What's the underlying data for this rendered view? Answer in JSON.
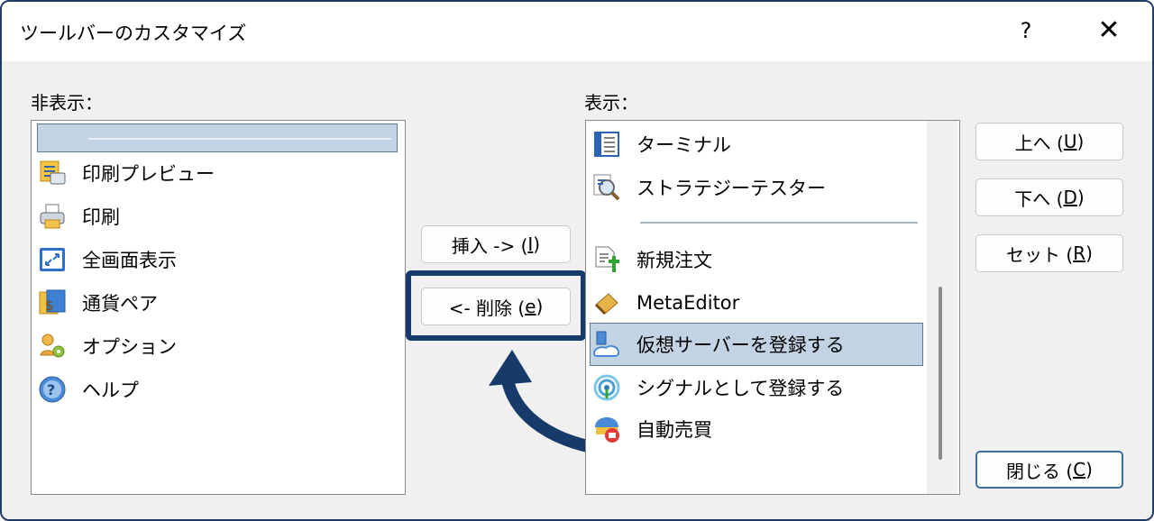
{
  "dialog": {
    "title": "ツールバーのカスタマイズ",
    "help_label": "?",
    "close_label": "✕"
  },
  "hidden_list": {
    "label": "非表示：",
    "items": [
      {
        "label": "",
        "icon": "separator",
        "selected": true
      },
      {
        "label": "印刷プレビュー",
        "icon": "print-preview-icon"
      },
      {
        "label": "印刷",
        "icon": "printer-icon"
      },
      {
        "label": "全画面表示",
        "icon": "fullscreen-icon"
      },
      {
        "label": "通貨ペア",
        "icon": "currency-pair-icon"
      },
      {
        "label": "オプション",
        "icon": "options-icon"
      },
      {
        "label": "ヘルプ",
        "icon": "help-icon"
      }
    ]
  },
  "shown_list": {
    "label": "表示：",
    "items": [
      {
        "label": "ターミナル",
        "icon": "terminal-icon"
      },
      {
        "label": "ストラテジーテスター",
        "icon": "strategy-tester-icon"
      },
      {
        "label": "",
        "icon": "separator"
      },
      {
        "label": "新規注文",
        "icon": "new-order-icon"
      },
      {
        "label": "MetaEditor",
        "icon": "metaeditor-icon"
      },
      {
        "label": "仮想サーバーを登録する",
        "icon": "virtual-server-icon",
        "selected": true
      },
      {
        "label": "シグナルとして登録する",
        "icon": "signal-icon"
      },
      {
        "label": "自動売買",
        "icon": "auto-trading-icon"
      }
    ]
  },
  "buttons": {
    "insert": {
      "text": "挿入 -> (",
      "key": "I",
      "end": ")"
    },
    "delete": {
      "text": "<- 削除 (",
      "key": "e",
      "end": ")"
    },
    "up": {
      "text": "上へ (",
      "key": "U",
      "end": ")"
    },
    "down": {
      "text": "下へ (",
      "key": "D",
      "end": ")"
    },
    "reset": {
      "text": "セット (",
      "key": "R",
      "end": ")"
    },
    "close": {
      "text": "閉じる (",
      "key": "C",
      "end": ")"
    }
  },
  "colors": {
    "accent": "#163a6a",
    "selection": "#c2d3e4"
  }
}
